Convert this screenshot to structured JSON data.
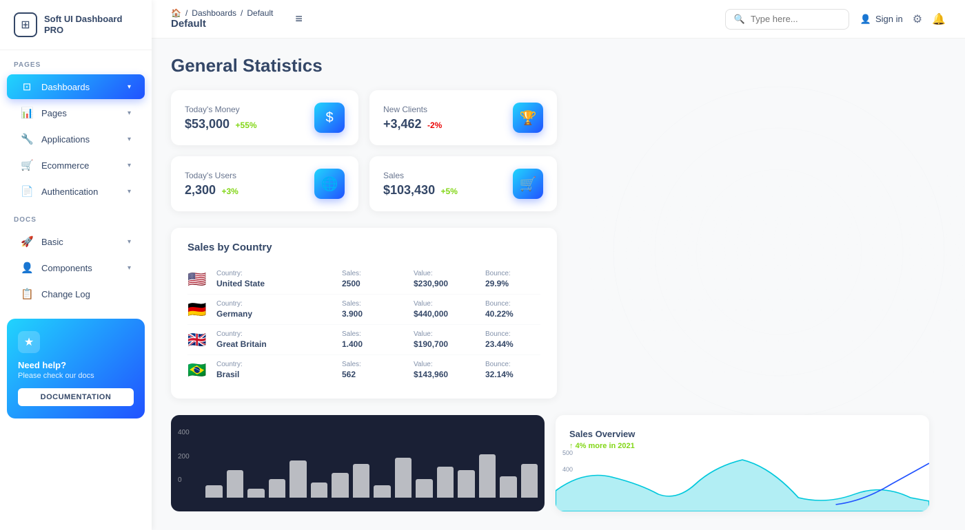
{
  "logo": {
    "icon": "⊞",
    "text": "Soft UI Dashboard PRO"
  },
  "sidebar": {
    "sections": [
      {
        "label": "PAGES",
        "items": [
          {
            "id": "dashboards",
            "label": "Dashboards",
            "icon": "⊡",
            "active": true,
            "chevron": "▾"
          },
          {
            "id": "pages",
            "label": "Pages",
            "icon": "📊",
            "active": false,
            "chevron": "▾"
          },
          {
            "id": "applications",
            "label": "Applications",
            "icon": "🔧",
            "active": false,
            "chevron": "▾"
          },
          {
            "id": "ecommerce",
            "label": "Ecommerce",
            "icon": "🛒",
            "active": false,
            "chevron": "▾"
          },
          {
            "id": "authentication",
            "label": "Authentication",
            "icon": "📄",
            "active": false,
            "chevron": "▾"
          }
        ]
      },
      {
        "label": "DOCS",
        "items": [
          {
            "id": "basic",
            "label": "Basic",
            "icon": "🚀",
            "active": false,
            "chevron": "▾"
          },
          {
            "id": "components",
            "label": "Components",
            "icon": "👤",
            "active": false,
            "chevron": "▾"
          },
          {
            "id": "changelog",
            "label": "Change Log",
            "icon": "📋",
            "active": false,
            "chevron": ""
          }
        ]
      }
    ],
    "help": {
      "star": "★",
      "title": "Need help?",
      "subtitle": "Please check our docs",
      "button": "DOCUMENTATION"
    }
  },
  "topbar": {
    "breadcrumb": [
      "🏠",
      "/",
      "Dashboards",
      "/",
      "Default"
    ],
    "current_page": "Default",
    "menu_icon": "≡",
    "search_placeholder": "Type here...",
    "signin_label": "Sign in",
    "gear_icon": "⚙",
    "bell_icon": "🔔"
  },
  "page": {
    "title": "General Statistics"
  },
  "stats": [
    {
      "label": "Today's Money",
      "value": "$53,000",
      "change": "+55%",
      "change_type": "positive",
      "icon": "$"
    },
    {
      "label": "New Clients",
      "value": "+3,462",
      "change": "-2%",
      "change_type": "negative",
      "icon": "🏆"
    },
    {
      "label": "Today's Users",
      "value": "2,300",
      "change": "+3%",
      "change_type": "positive",
      "icon": "🌐"
    },
    {
      "label": "Sales",
      "value": "$103,430",
      "change": "+5%",
      "change_type": "positive",
      "icon": "🛒"
    }
  ],
  "sales_by_country": {
    "title": "Sales by Country",
    "columns": [
      "Country:",
      "Sales:",
      "Value:",
      "Bounce:"
    ],
    "rows": [
      {
        "flag": "🇺🇸",
        "country": "United State",
        "sales": "2500",
        "value": "$230,900",
        "bounce": "29.9%"
      },
      {
        "flag": "🇩🇪",
        "country": "Germany",
        "sales": "3.900",
        "value": "$440,000",
        "bounce": "40.22%"
      },
      {
        "flag": "🇬🇧",
        "country": "Great Britain",
        "sales": "1.400",
        "value": "$190,700",
        "bounce": "23.44%"
      },
      {
        "flag": "🇧🇷",
        "country": "Brasil",
        "sales": "562",
        "value": "$143,960",
        "bounce": "32.14%"
      }
    ]
  },
  "bar_chart": {
    "y_labels": [
      "400",
      "200",
      "0"
    ],
    "bars": [
      20,
      45,
      15,
      30,
      60,
      25,
      40,
      55,
      20,
      65,
      30,
      50,
      45,
      70,
      35,
      55
    ]
  },
  "sales_overview": {
    "title": "Sales Overview",
    "subtitle_prefix": "4% more in 2021",
    "y_labels": [
      "500",
      "400"
    ],
    "accent_color": "#82d616"
  }
}
